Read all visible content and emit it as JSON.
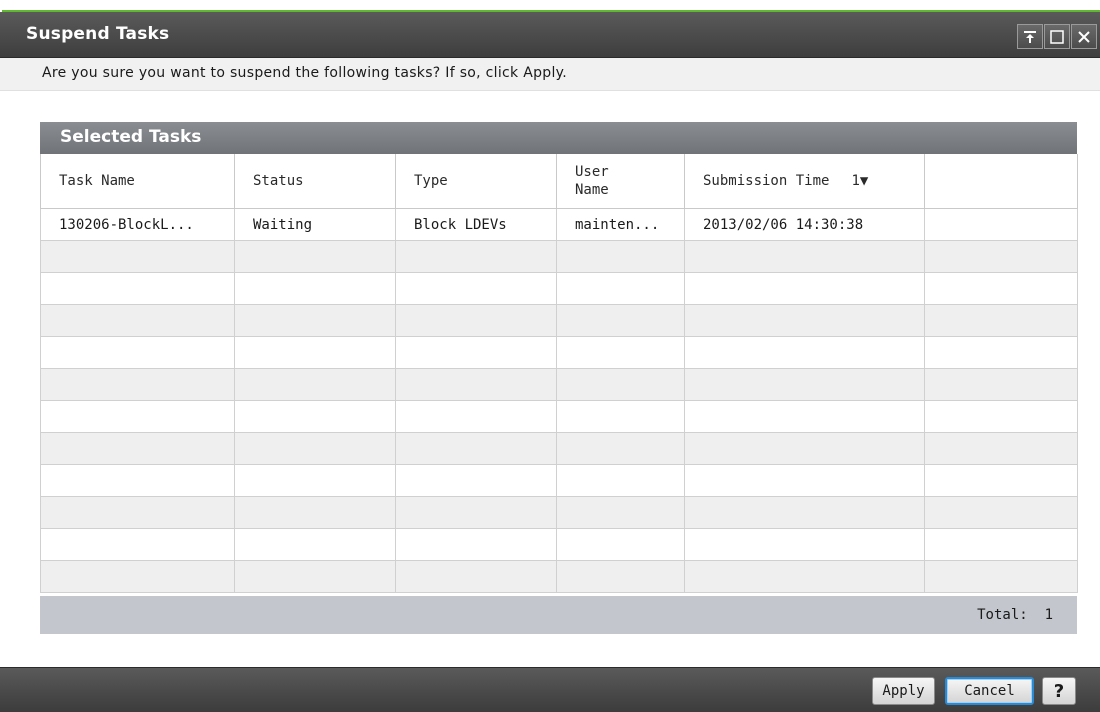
{
  "window": {
    "title": "Suspend Tasks",
    "controls": [
      "pin-icon",
      "maximize-icon",
      "close-icon"
    ]
  },
  "message": "Are you sure you want to suspend the following tasks? If so, click Apply.",
  "panel": {
    "title": "Selected Tasks",
    "columns": {
      "task_name": "Task Name",
      "status": "Status",
      "type": "Type",
      "user_name_1": "User",
      "user_name_2": "Name",
      "submission_time": "Submission Time",
      "sort_indicator": "1▼"
    },
    "rows": [
      {
        "task_name": "130206-BlockL...",
        "status": "Waiting",
        "type": "Block LDEVs",
        "user_name": "mainten...",
        "submission_time": "2013/02/06 14:30:38"
      }
    ],
    "total_label": "Total:",
    "total_value": "1"
  },
  "buttons": {
    "apply": "Apply",
    "cancel": "Cancel",
    "help": "?"
  },
  "colors": {
    "title_bar": "#4a4a4a",
    "accent_line": "#5fb82e",
    "panel_header": "#7d8085",
    "focus": "#2a8ad4"
  }
}
